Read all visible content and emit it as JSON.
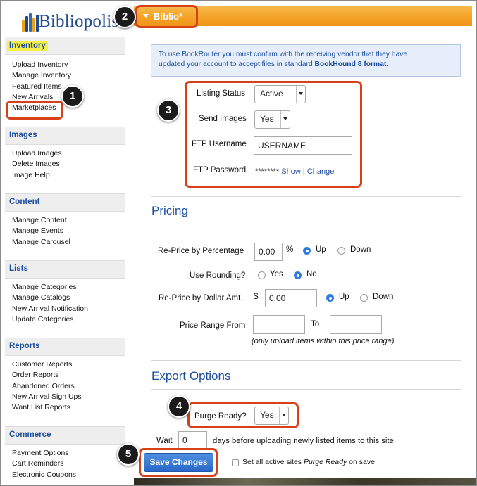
{
  "brand": {
    "logo_text": "Bibliopolis"
  },
  "colors": {
    "accent_orange": "#f4a124",
    "link_blue": "#1d4e9e",
    "callout_red": "#d8401a",
    "highlight_yellow": "#f6ef45",
    "button_blue": "#2a68c9"
  },
  "sidebar": {
    "sections": [
      {
        "title": "Inventory",
        "items": [
          "Upload Inventory",
          "Manage Inventory",
          "Featured Items",
          "New Arrivals",
          "Marketplaces"
        ]
      },
      {
        "title": "Images",
        "items": [
          "Upload Images",
          "Delete Images",
          "Image Help"
        ]
      },
      {
        "title": "Content",
        "items": [
          "Manage Content",
          "Manage Events",
          "Manage Carousel"
        ]
      },
      {
        "title": "Lists",
        "items": [
          "Manage Categories",
          "Manage Catalogs",
          "New Arrival Notification",
          "Update Categories"
        ]
      },
      {
        "title": "Reports",
        "items": [
          "Customer Reports",
          "Order Reports",
          "Abandoned Orders",
          "New Arrival Sign Ups",
          "Want List Reports"
        ]
      },
      {
        "title": "Commerce",
        "items": [
          "Payment Options",
          "Cart Reminders",
          "Electronic Coupons"
        ]
      }
    ]
  },
  "header": {
    "tab_label": "Biblio*"
  },
  "notice": {
    "line1": "To use BookRouter you must confirm with the receiving vendor that they have",
    "line2_prefix": "updated your account to accept files in standard ",
    "line2_bold": "BookHound 8 format."
  },
  "listing": {
    "status_label": "Listing Status",
    "status_value": "Active",
    "images_label": "Send Images",
    "images_value": "Yes",
    "ftp_user_label": "FTP Username",
    "ftp_user_value": "USERNAME",
    "ftp_pass_label": "FTP Password",
    "ftp_pass_mask": "********",
    "show_link": "Show",
    "separator": "|",
    "change_link": "Change"
  },
  "pricing": {
    "heading": "Pricing",
    "percent_label": "Re-Price by Percentage",
    "percent_value": "0.00",
    "percent_unit": "%",
    "up_label": "Up",
    "down_label": "Down",
    "rounding_label": "Use Rounding?",
    "yes_label": "Yes",
    "no_label": "No",
    "dollar_label": "Re-Price by Dollar Amt.",
    "dollar_symbol": "$",
    "dollar_value": "0.00",
    "range_label": "Price Range From",
    "to_label": "To",
    "range_note": "(only upload items within this price range)"
  },
  "export": {
    "heading": "Export Options",
    "purge_label": "Purge Ready?",
    "purge_value": "Yes",
    "wait_label": "Wait",
    "wait_value": "0",
    "wait_suffix": "days before uploading newly listed items to this site.",
    "save_button": "Save Changes",
    "set_all_prefix": "Set all active sites ",
    "set_all_italic": "Purge Ready",
    "set_all_suffix": " on save"
  },
  "callouts": [
    "1",
    "2",
    "3",
    "4",
    "5"
  ]
}
